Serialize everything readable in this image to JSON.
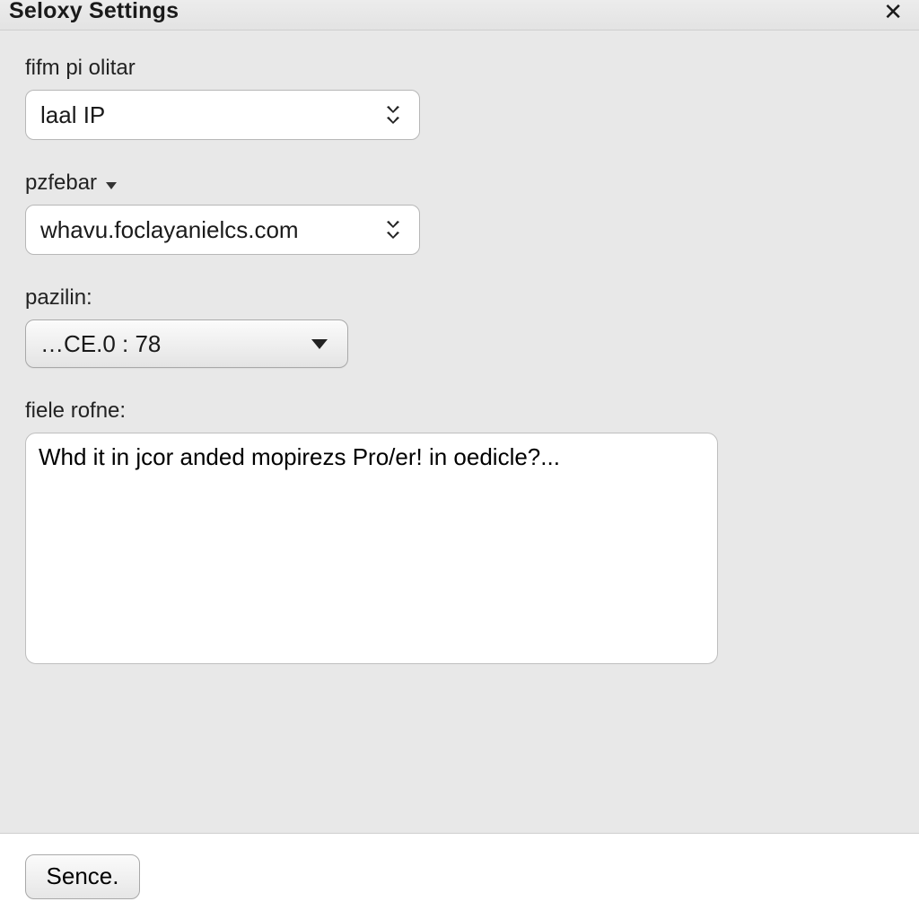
{
  "window": {
    "title": "Seloxy Settings"
  },
  "fields": {
    "source_ip": {
      "label": "fifm pi olitar",
      "selected": "laal IP"
    },
    "host": {
      "label": "pzfebar",
      "selected": "whavu.foclayanielcs.com"
    },
    "version": {
      "label": "pazilin:",
      "selected": "…CE.0 : 78"
    },
    "notes": {
      "label": "fiele rofne:",
      "value": "Whd it in jcor anded mopirezs Pro/er! in oedicle?..."
    }
  },
  "buttons": {
    "primary": "Sence."
  }
}
